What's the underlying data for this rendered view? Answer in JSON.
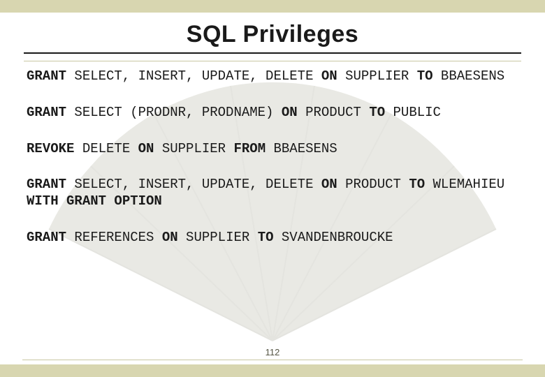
{
  "slide": {
    "title": "SQL Privileges",
    "page_number": "112",
    "statements": [
      {
        "segments": [
          {
            "t": "GRANT",
            "kw": true
          },
          {
            "t": " SELECT, INSERT, UPDATE, DELETE "
          },
          {
            "t": "ON",
            "kw": true
          },
          {
            "t": " SUPPLIER "
          },
          {
            "t": "TO",
            "kw": true
          },
          {
            "t": " BBAESENS"
          }
        ]
      },
      {
        "segments": [
          {
            "t": "GRANT",
            "kw": true
          },
          {
            "t": " SELECT (PRODNR, PRODNAME) "
          },
          {
            "t": "ON",
            "kw": true
          },
          {
            "t": " PRODUCT "
          },
          {
            "t": "TO",
            "kw": true
          },
          {
            "t": " PUBLIC"
          }
        ]
      },
      {
        "segments": [
          {
            "t": "REVOKE",
            "kw": true
          },
          {
            "t": " DELETE "
          },
          {
            "t": "ON",
            "kw": true
          },
          {
            "t": " SUPPLIER "
          },
          {
            "t": "FROM",
            "kw": true
          },
          {
            "t": " BBAESENS"
          }
        ]
      },
      {
        "segments": [
          {
            "t": "GRANT",
            "kw": true
          },
          {
            "t": " SELECT, INSERT, UPDATE, DELETE "
          },
          {
            "t": "ON",
            "kw": true
          },
          {
            "t": " PRODUCT "
          },
          {
            "t": "TO",
            "kw": true
          },
          {
            "t": " WLEMAHIEU "
          },
          {
            "t": "WITH GRANT OPTION",
            "kw": true
          }
        ]
      },
      {
        "segments": [
          {
            "t": "GRANT",
            "kw": true
          },
          {
            "t": " REFERENCES "
          },
          {
            "t": "ON",
            "kw": true
          },
          {
            "t": " SUPPLIER "
          },
          {
            "t": "TO",
            "kw": true
          },
          {
            "t": " SVANDENBROUCKE"
          }
        ]
      }
    ]
  }
}
